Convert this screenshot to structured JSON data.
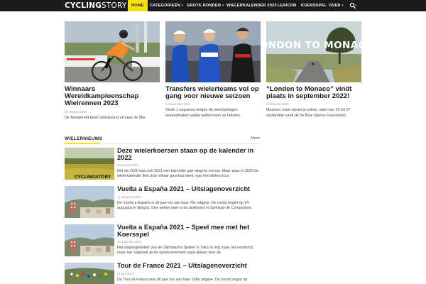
{
  "nav": {
    "logo": {
      "bold": "CYCLING",
      "light": "STORY"
    },
    "items": [
      {
        "label": "HOME",
        "dropdown": false,
        "active": true
      },
      {
        "label": "CATEGORIEËN",
        "dropdown": true,
        "active": false
      },
      {
        "label": "GROTE RONDEN",
        "dropdown": true,
        "active": false
      },
      {
        "label": "WIELERKALENDER 2022",
        "dropdown": false,
        "active": false
      },
      {
        "label": "LEXICON",
        "dropdown": false,
        "active": false
      },
      {
        "label": "KOERSSPEL",
        "dropdown": false,
        "active": false
      },
      {
        "label": "OVER",
        "dropdown": true,
        "active": false
      }
    ],
    "dropdown_caret": "˅",
    "search_icon": "search-icon"
  },
  "featured": [
    {
      "title": "Winnaars Wereldkampioenschap Wielrennen 2023",
      "date": "10 oktober 2023",
      "excerpt": "De fietswereld keek reikhalzend uit naar de 96e"
    },
    {
      "title": "Transfers wielerteams vol op gang voor nieuwe seizoen",
      "date": "5 september 2022",
      "excerpt": "Sinds 1 augustus mogen de wielerploegen bekendmaken welke wielrenners ze hebben"
    },
    {
      "title": "“Londen to Monaco” vindt plaats in september 2022!",
      "date": "23 februari 2022",
      "excerpt": "Masseer maar alvast je kuiten, want van 20 tot 27 september vindt de 5e Blue Marine Foundation",
      "image_text": "LONDON TO MONACO"
    }
  ],
  "section": {
    "title": "WIELERNIEUWS",
    "more": "Meer"
  },
  "list": [
    {
      "title": "Deze wielerkoersen staan op de kalender in 2022",
      "date": "23 januari 2022",
      "excerpt": "Net als 2020 was ook 2021 een bijzonder jaar wegens corona. Maar waar in 2020 de wielerkalender flink door elkaar geschud werd, was het wielercircus",
      "image_text": "CYCLINGSTORY"
    },
    {
      "title": "Vuelta a España 2021 – Uitslagenoverzicht",
      "date": "11 augustus 2021",
      "excerpt": "De Vuelta a España is dit jaar toe aan haar 76e uitgave. De ronde begint op 14 augustus in Burgos. Drie weken later is de aankomst in Santiago de Compostela. Cycling Story zet de belangrijkste uitslagen elke dag op een rij."
    },
    {
      "title": "Vuelta a España 2021 – Speel mee met het Koersspel",
      "date": "10 augustus 2021",
      "excerpt": "Het wapengekletter van de Olympische Spelen in Tokio is nog maar net verstomd, maar het volgende grote sportevenement staat alweer voor de"
    },
    {
      "title": "Tour de France 2021 – Uitslagenoverzicht",
      "date": "26 juni 2021",
      "excerpt": "De Tour de France was dit jaar toe aan haar 108e uitgave. De ronde begon op"
    }
  ],
  "colors": {
    "accent": "#f7e011",
    "nav_bg": "#1a1a1a"
  }
}
